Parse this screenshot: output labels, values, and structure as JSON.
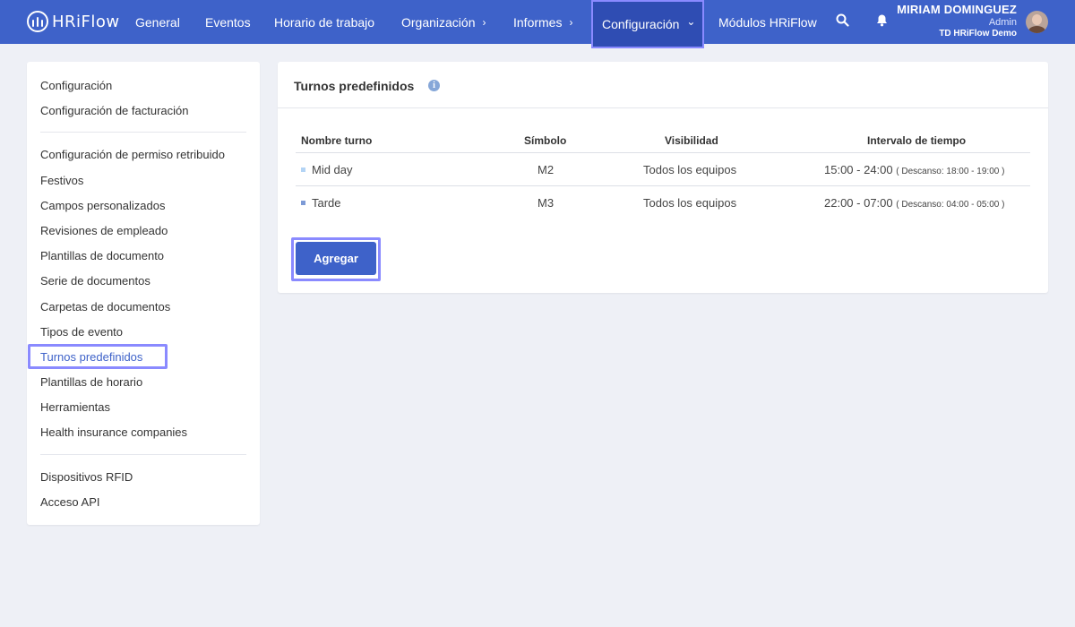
{
  "app": {
    "logo_text": "HRiFlow"
  },
  "nav": {
    "items": [
      {
        "label": "General",
        "chevron": ""
      },
      {
        "label": "Eventos",
        "chevron": ""
      },
      {
        "label": "Horario de trabajo",
        "chevron": ""
      },
      {
        "label": "Organización",
        "chevron": "›"
      },
      {
        "label": "Informes",
        "chevron": "›"
      },
      {
        "label": "Configuración",
        "chevron": "⌄"
      },
      {
        "label": "Módulos HRiFlow",
        "chevron": ""
      }
    ],
    "active_index": 5
  },
  "user": {
    "name": "MIRIAM DOMINGUEZ",
    "role": "Admin",
    "company": "TD HRiFlow Demo"
  },
  "sidebar": {
    "items": [
      {
        "label": "Configuración"
      },
      {
        "label": "Configuración de facturación"
      },
      {
        "label": "Configuración de permiso retribuido"
      },
      {
        "label": "Festivos"
      },
      {
        "label": "Campos personalizados"
      },
      {
        "label": "Revisiones de empleado"
      },
      {
        "label": "Plantillas de documento"
      },
      {
        "label": "Serie de documentos"
      },
      {
        "label": "Carpetas de documentos"
      },
      {
        "label": "Tipos de evento"
      },
      {
        "label": "Turnos predefinidos"
      },
      {
        "label": "Plantillas de horario"
      },
      {
        "label": "Herramientas"
      },
      {
        "label": "Health insurance companies"
      },
      {
        "label": "Dispositivos RFID"
      },
      {
        "label": "Acceso API"
      }
    ],
    "active_index": 10
  },
  "main": {
    "title": "Turnos predefinidos",
    "info_icon": "i",
    "table": {
      "headers": [
        "Nombre turno",
        "Símbolo",
        "Visibilidad",
        "Intervalo de tiempo"
      ],
      "rows": [
        {
          "name": "Mid day",
          "color": "#b3d4f5",
          "symbol": "M2",
          "visibility": "Todos los equipos",
          "interval": "15:00 - 24:00",
          "break": "( Descanso: 18:00 - 19:00 )"
        },
        {
          "name": "Tarde",
          "color": "#7d9ad6",
          "symbol": "M3",
          "visibility": "Todos los equipos",
          "interval": "22:00 - 07:00",
          "break": "( Descanso: 04:00 - 05:00 )"
        }
      ]
    },
    "add_button": "Agregar"
  },
  "colors": {
    "topbar": "#3e62c9",
    "active_nav": "#2f4db3",
    "highlight": "#8a8aff",
    "background": "#eef0f6"
  },
  "icons": [
    "logo-icon",
    "search-icon",
    "bell-icon",
    "info-icon",
    "avatar"
  ]
}
